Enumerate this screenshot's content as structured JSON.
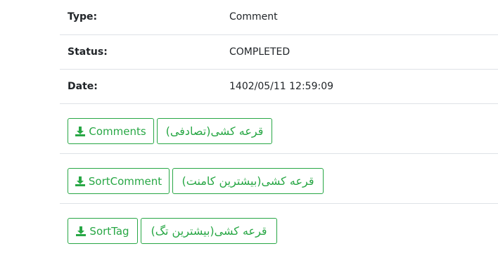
{
  "details": {
    "type_label": "Type:",
    "type_value": "Comment",
    "status_label": "Status:",
    "status_value": "COMPLETED",
    "date_label": "Date:",
    "date_value": "1402/05/11 12:59:09"
  },
  "actions": {
    "comments_label": "Comments",
    "random_draw_label": "قرعه کشی(تصادفی)",
    "sortcomment_label": "SortComment",
    "most_comments_draw_label": "قرعه کشی(بیشترین کامنت)",
    "sorttag_label": "SortTag",
    "most_tags_draw_label": "قرعه کشی(بیشترین تگ)"
  },
  "colors": {
    "success_green": "#28a745",
    "divider": "#dee2e6"
  },
  "icons": {
    "download": "download-icon"
  }
}
